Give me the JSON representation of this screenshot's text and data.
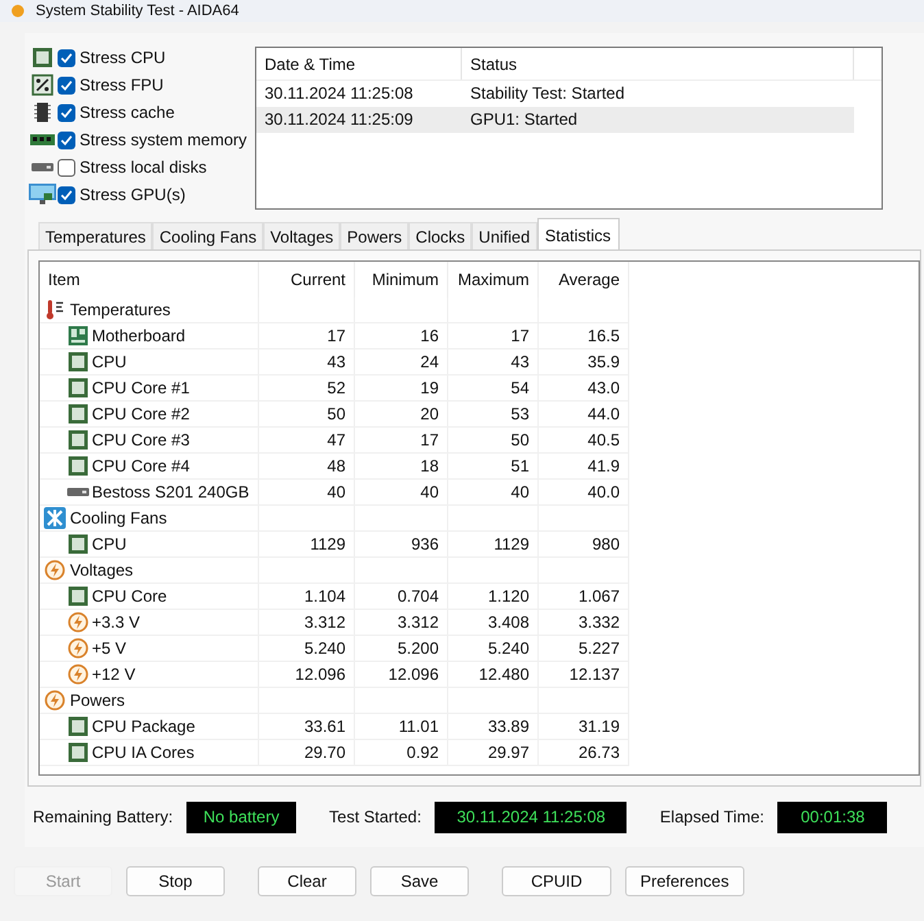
{
  "window": {
    "title": "System Stability Test - AIDA64"
  },
  "stress_options": [
    {
      "label": "Stress CPU",
      "kind": "cpu",
      "checked": true
    },
    {
      "label": "Stress FPU",
      "kind": "fpu",
      "checked": true
    },
    {
      "label": "Stress cache",
      "kind": "cache",
      "checked": true
    },
    {
      "label": "Stress system memory",
      "kind": "memory",
      "checked": true
    },
    {
      "label": "Stress local disks",
      "kind": "disk",
      "checked": false
    },
    {
      "label": "Stress GPU(s)",
      "kind": "gpu",
      "checked": true
    }
  ],
  "log": {
    "columns": [
      "Date & Time",
      "Status"
    ],
    "rows": [
      {
        "time": "30.11.2024 11:25:08",
        "status": "Stability Test: Started",
        "selected": false
      },
      {
        "time": "30.11.2024 11:25:09",
        "status": "GPU1: Started",
        "selected": true
      }
    ]
  },
  "tabs": [
    {
      "label": "Temperatures",
      "selected": false
    },
    {
      "label": "Cooling Fans",
      "selected": false
    },
    {
      "label": "Voltages",
      "selected": false
    },
    {
      "label": "Powers",
      "selected": false
    },
    {
      "label": "Clocks",
      "selected": false
    },
    {
      "label": "Unified",
      "selected": false
    },
    {
      "label": "Statistics",
      "selected": true
    }
  ],
  "stats": {
    "columns": [
      "Item",
      "Current",
      "Minimum",
      "Maximum",
      "Average"
    ],
    "groups": [
      {
        "label": "Temperatures",
        "kind": "thermometer",
        "children": [
          {
            "label": "Motherboard",
            "kind": "board",
            "values": [
              "17",
              "16",
              "17",
              "16.5"
            ]
          },
          {
            "label": "CPU",
            "kind": "chip",
            "values": [
              "43",
              "24",
              "43",
              "35.9"
            ]
          },
          {
            "label": "CPU Core #1",
            "kind": "chip",
            "values": [
              "52",
              "19",
              "54",
              "43.0"
            ]
          },
          {
            "label": "CPU Core #2",
            "kind": "chip",
            "values": [
              "50",
              "20",
              "53",
              "44.0"
            ]
          },
          {
            "label": "CPU Core #3",
            "kind": "chip",
            "values": [
              "47",
              "17",
              "50",
              "40.5"
            ]
          },
          {
            "label": "CPU Core #4",
            "kind": "chip",
            "values": [
              "48",
              "18",
              "51",
              "41.9"
            ]
          },
          {
            "label": "Bestoss S201 240GB",
            "kind": "drive",
            "values": [
              "40",
              "40",
              "40",
              "40.0"
            ]
          }
        ]
      },
      {
        "label": "Cooling Fans",
        "kind": "fan",
        "children": [
          {
            "label": "CPU",
            "kind": "chip",
            "values": [
              "1129",
              "936",
              "1129",
              "980"
            ]
          }
        ]
      },
      {
        "label": "Voltages",
        "kind": "bolt",
        "children": [
          {
            "label": "CPU Core",
            "kind": "chip",
            "values": [
              "1.104",
              "0.704",
              "1.120",
              "1.067"
            ]
          },
          {
            "label": "+3.3 V",
            "kind": "bolt",
            "values": [
              "3.312",
              "3.312",
              "3.408",
              "3.332"
            ]
          },
          {
            "label": "+5 V",
            "kind": "bolt",
            "values": [
              "5.240",
              "5.200",
              "5.240",
              "5.227"
            ]
          },
          {
            "label": "+12 V",
            "kind": "bolt",
            "values": [
              "12.096",
              "12.096",
              "12.480",
              "12.137"
            ]
          }
        ]
      },
      {
        "label": "Powers",
        "kind": "bolt",
        "children": [
          {
            "label": "CPU Package",
            "kind": "chip",
            "values": [
              "33.61",
              "11.01",
              "33.89",
              "31.19"
            ]
          },
          {
            "label": "CPU IA Cores",
            "kind": "chip",
            "values": [
              "29.70",
              "0.92",
              "29.97",
              "26.73"
            ]
          }
        ]
      }
    ]
  },
  "status": [
    {
      "label": "Remaining Battery:",
      "value": "No battery"
    },
    {
      "label": "Test Started:",
      "value": "30.11.2024 11:25:08"
    },
    {
      "label": "Elapsed Time:",
      "value": "00:01:38"
    }
  ],
  "buttons": [
    {
      "label": "Start",
      "disabled": true
    },
    {
      "label": "Stop",
      "disabled": false
    },
    {
      "label": "Clear",
      "disabled": false
    },
    {
      "label": "Save",
      "disabled": false
    },
    {
      "label": "CPUID",
      "disabled": false
    },
    {
      "label": "Preferences",
      "disabled": false
    }
  ]
}
